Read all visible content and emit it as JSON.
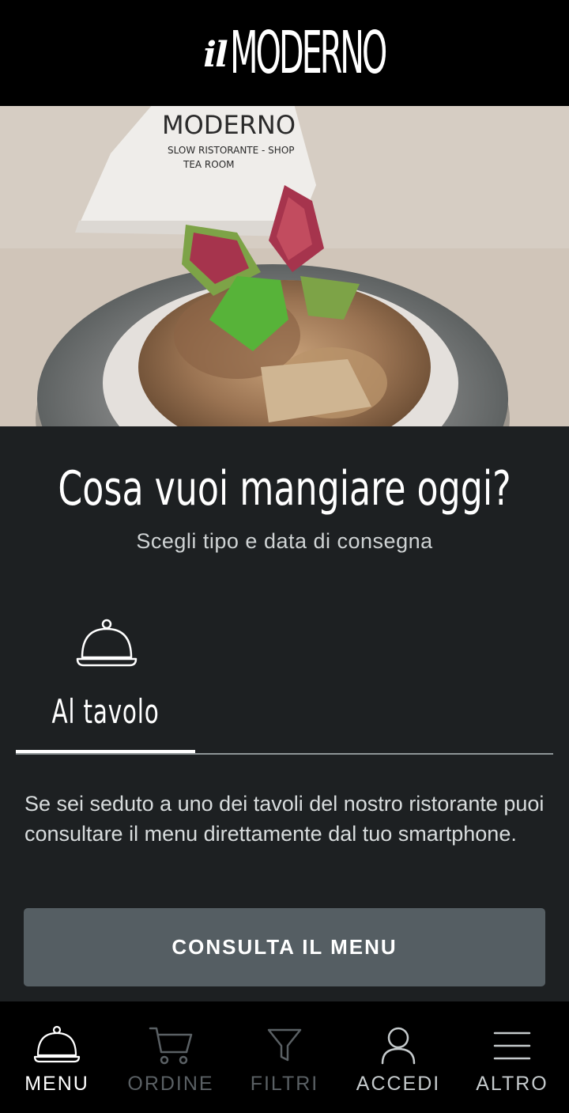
{
  "header": {
    "logo_prefix": "il",
    "logo_text": "MODERNO"
  },
  "hero": {
    "alt": "dish"
  },
  "main": {
    "title": "Cosa vuoi mangiare oggi?",
    "subtitle": "Scegli tipo e data di consegna",
    "tabs": [
      {
        "label": "Al tavolo",
        "icon": "cloche-icon",
        "active": true
      }
    ],
    "description": "Se sei seduto a uno dei tavoli del nostro ristorante puoi consultare il menu direttamente dal tuo smartphone.",
    "cta_label": "CONSULTA IL MENU"
  },
  "bottom_nav": [
    {
      "label": "MENU",
      "icon": "cloche-icon",
      "state": "active"
    },
    {
      "label": "ORDINE",
      "icon": "cart-icon",
      "state": "muted"
    },
    {
      "label": "FILTRI",
      "icon": "filter-icon",
      "state": "muted"
    },
    {
      "label": "ACCEDI",
      "icon": "user-icon",
      "state": "normal"
    },
    {
      "label": "ALTRO",
      "icon": "menu-icon",
      "state": "normal"
    }
  ],
  "colors": {
    "background": "#1d2022",
    "header": "#000000",
    "cta": "#555e63",
    "muted": "#5a6064"
  }
}
